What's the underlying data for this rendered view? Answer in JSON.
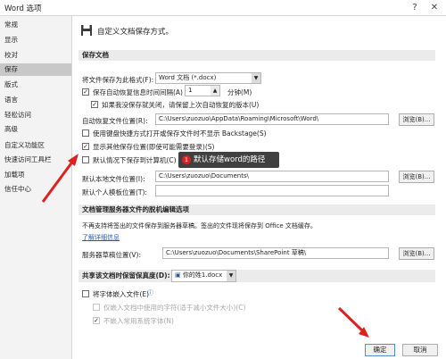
{
  "window": {
    "title": "Word 选项",
    "help": "?",
    "close": "✕"
  },
  "sidebar": {
    "items": [
      {
        "label": "常规"
      },
      {
        "label": "显示"
      },
      {
        "label": "校对"
      },
      {
        "label": "保存"
      },
      {
        "label": "版式"
      },
      {
        "label": "语言"
      },
      {
        "label": "轻松访问"
      },
      {
        "label": "高级"
      },
      {
        "label": "自定义功能区"
      },
      {
        "label": "快速访问工具栏"
      },
      {
        "label": "加载项"
      },
      {
        "label": "信任中心"
      }
    ],
    "active_index": 3
  },
  "header": {
    "title": "自定义文档保存方式。"
  },
  "save_docs": {
    "section_title": "保存文档",
    "format_label": "将文件保存为此格式(F):",
    "format_value": "Word 文档 (*.docx)",
    "autorecover_label": "保存自动恢复信息时间间隔(A)",
    "autorecover_value": "1",
    "autorecover_unit": "分钟(M)",
    "keep_last_label": "如果我没保存就关闭，请保留上次自动恢复的版本(U)",
    "autorecover_path_label": "自动恢复文件位置(R):",
    "autorecover_path_value": "C:\\Users\\zuozuo\\AppData\\Roaming\\Microsoft\\Word\\",
    "browse_label": "浏览(B)...",
    "no_backstage_label": "使用键盘快捷方式打开或保存文件时不显示 Backstage(S)",
    "show_more_locations_label": "显示其他保存位置(即使可能需要登录)(S)",
    "save_to_computer_label": "默认情况下保存到计算机(C)",
    "local_path_label": "默认本地文件位置(I):",
    "local_path_value": "C:\\Users\\zuozuo\\Documents\\",
    "browse2_label": "浏览(B)...",
    "templates_label": "默认个人模板位置(T):",
    "templates_value": ""
  },
  "tooltip": {
    "number": "1",
    "text": "默认存储word的路径"
  },
  "offline": {
    "section_title": "文档管理服务器文件的脱机编辑选项",
    "desc": "不再支持将签出的文件保存到服务器草稿。签出的文件现将保存到 Office 文档缓存。",
    "link": "了解详细信息",
    "drafts_label": "服务器草稿位置(V):",
    "drafts_value": "C:\\Users\\zuozuo\\Documents\\SharePoint 草稿\\",
    "browse_label": "浏览(B)..."
  },
  "fidelity": {
    "section_title": "共享该文档时保留保真度(D):",
    "doc_value": "你的姓1.docx",
    "embed_fonts_label": "将字体嵌入文件(E)",
    "embed_used_only_label": "仅嵌入文档中使用的字符(适于减小文件大小)(C)",
    "no_system_fonts_label": "不嵌入常用系统字体(N)"
  },
  "footer": {
    "ok_label": "确定",
    "cancel_label": "取消"
  },
  "colors": {
    "accent": "#e02020",
    "active": "#c8c8c8"
  }
}
